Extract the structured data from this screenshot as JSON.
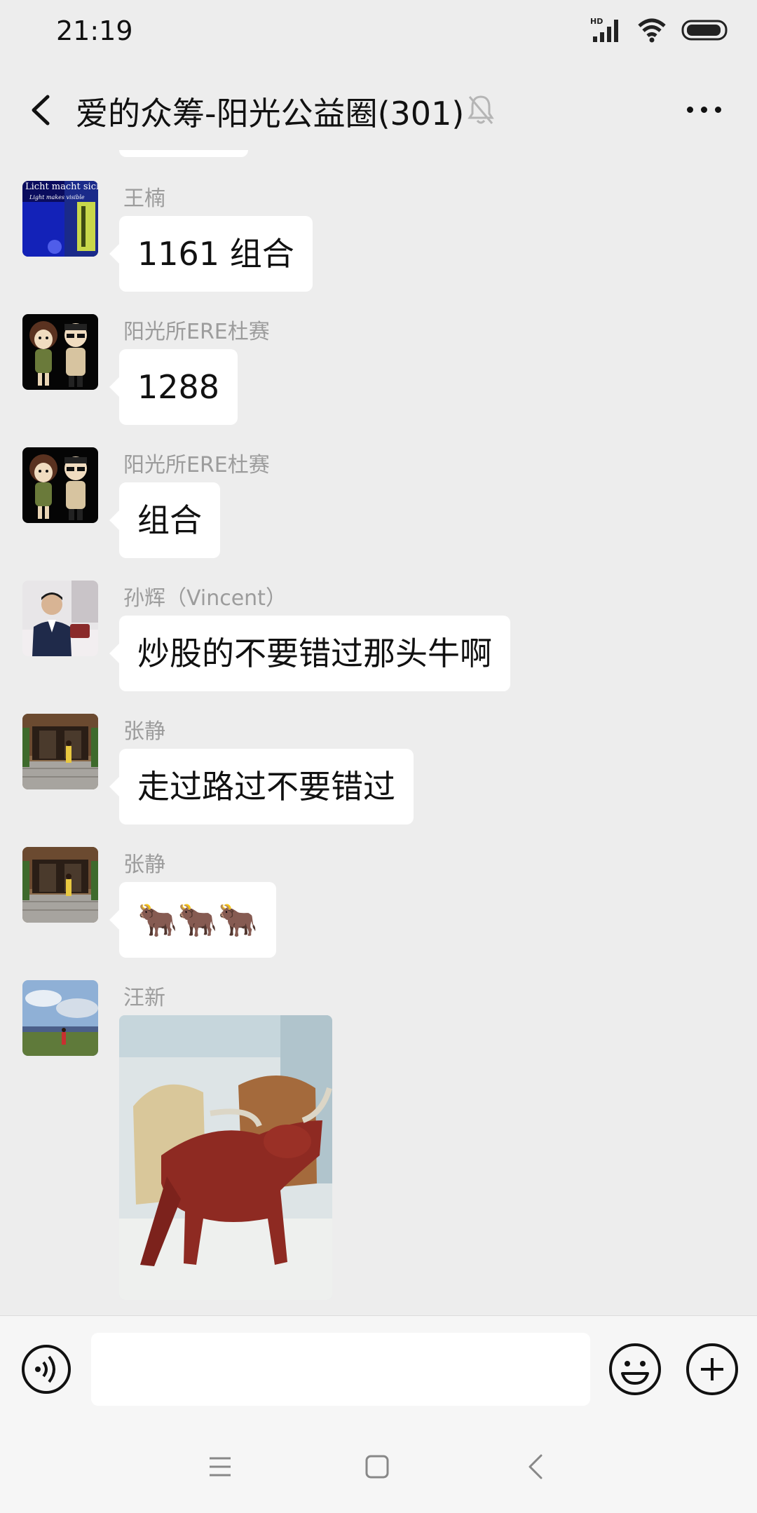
{
  "status": {
    "time": "21:19",
    "hd_label": "HD"
  },
  "header": {
    "title": "爱的众筹-阳光公益圈(301)"
  },
  "messages": [
    {
      "sender": "王楠",
      "text": "1161 组合",
      "avatar": "light-art-avatar",
      "avatar_text": "Licht macht sichtbar",
      "avatar_subtext": "Light makes visible"
    },
    {
      "sender": "阳光所ERE杜赛",
      "text": "1288",
      "avatar": "cartoon-couple-avatar"
    },
    {
      "sender": "阳光所ERE杜赛",
      "text": "组合",
      "avatar": "cartoon-couple-avatar"
    },
    {
      "sender": "孙辉（Vincent）",
      "text": "炒股的不要错过那头牛啊",
      "avatar": "man-in-suit-avatar"
    },
    {
      "sender": "张静",
      "text": "走过路过不要错过",
      "avatar": "doorway-photo-avatar"
    },
    {
      "sender": "张静",
      "text": "🐂🐂🐂",
      "avatar": "doorway-photo-avatar"
    },
    {
      "sender": "汪新",
      "text": "",
      "avatar": "field-landscape-avatar",
      "image": "red-bull-figurine-photo"
    }
  ],
  "input": {
    "value": "",
    "placeholder": ""
  },
  "colors": {
    "background": "#ededed",
    "bubble": "#ffffff",
    "sender": "#9c9c9c",
    "text": "#111111"
  }
}
